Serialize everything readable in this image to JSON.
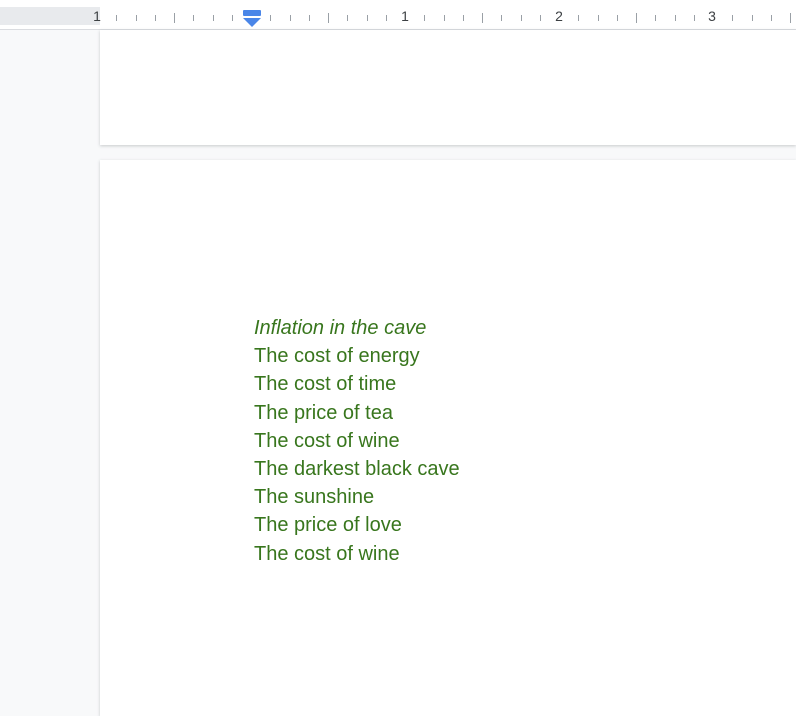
{
  "ruler": {
    "numbers": [
      "1",
      "1",
      "2",
      "3"
    ]
  },
  "document": {
    "text_color": "#38761d",
    "title": "Inflation in the cave",
    "lines": [
      "The cost of energy",
      "The cost of time",
      "The price of tea",
      "The cost of wine",
      "The darkest black cave",
      "The sunshine",
      "The price of love",
      "The cost of wine"
    ]
  },
  "icons": {
    "indent_marker": "first-line-indent-icon"
  },
  "colors": {
    "indent_marker": "#4a86e8",
    "page_background": "#f8f9fa"
  }
}
